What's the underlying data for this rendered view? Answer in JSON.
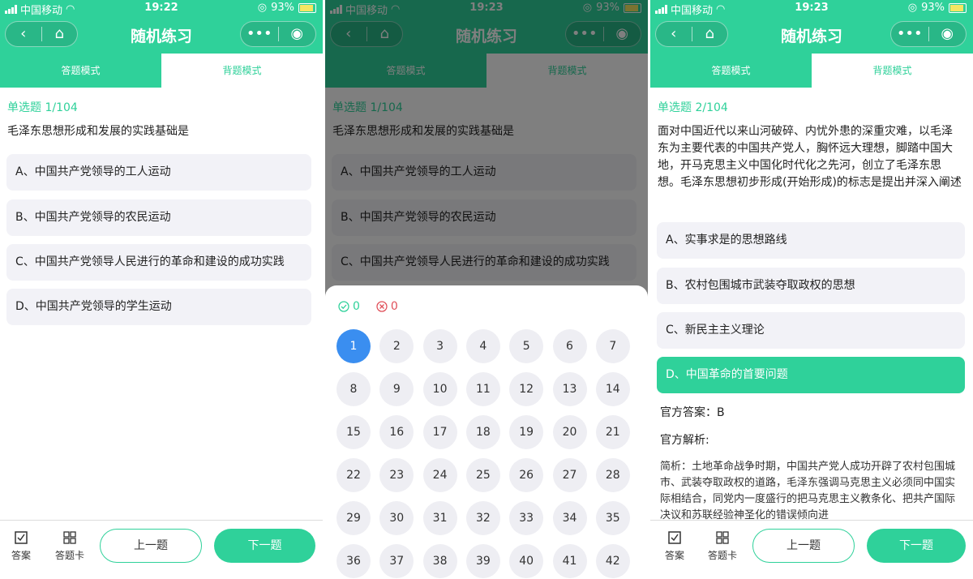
{
  "status": {
    "carrier": "中国移动",
    "battery": "93%"
  },
  "screens": [
    {
      "time": "19:22",
      "title": "随机练习",
      "tabs": [
        "答题模式",
        "背题模式"
      ],
      "question_label": "单选题 1/104",
      "question": "毛泽东思想形成和发展的实践基础是",
      "options": [
        "A、中国共产党领导的工人运动",
        "B、中国共产党领导的农民运动",
        "C、中国共产党领导人民进行的革命和建设的成功实践",
        "D、中国共产党领导的学生运动"
      ],
      "bottom": {
        "answer_label": "答案",
        "card_label": "答题卡",
        "prev": "上一题",
        "next": "下一题"
      }
    },
    {
      "time": "19:23",
      "title": "随机练习",
      "tabs": [
        "答题模式",
        "背题模式"
      ],
      "question_label": "单选题 1/104",
      "question": "毛泽东思想形成和发展的实践基础是",
      "options": [
        "A、中国共产党领导的工人运动",
        "B、中国共产党领导的农民运动",
        "C、中国共产党领导人民进行的革命和建设的成功实践"
      ],
      "sheet": {
        "correct_count": "0",
        "wrong_count": "0",
        "current": 1,
        "numbers": [
          "1",
          "2",
          "3",
          "4",
          "5",
          "6",
          "7",
          "8",
          "9",
          "10",
          "11",
          "12",
          "13",
          "14",
          "15",
          "16",
          "17",
          "18",
          "19",
          "20",
          "21",
          "22",
          "23",
          "24",
          "25",
          "26",
          "27",
          "28",
          "29",
          "30",
          "31",
          "32",
          "33",
          "34",
          "35",
          "36",
          "37",
          "38",
          "39",
          "40",
          "41",
          "42"
        ]
      }
    },
    {
      "time": "19:23",
      "title": "随机练习",
      "tabs": [
        "答题模式",
        "背题模式"
      ],
      "question_label": "单选题 2/104",
      "question": "面对中国近代以来山河破碎、内忧外患的深重灾难，以毛泽东为主要代表的中国共产党人，胸怀远大理想，脚踏中国大地，开马克思主义中国化时代化之先河，创立了毛泽东思想。毛泽东思想初步形成(开始形成)的标志是提出并深入阐述",
      "options": [
        "A、实事求是的思想路线",
        "B、农村包围城市武装夺取政权的思想",
        "C、新民主主义理论",
        "D、中国革命的首要问题"
      ],
      "selected_option": "D",
      "official_answer": "官方答案：B",
      "analysis_title": "官方解析:",
      "analysis": "简析：土地革命战争时期，中国共产党人成功开辟了农村包围城市、武装夺取政权的道路，毛泽东强调马克思主义必须同中国实际相结合，同党内一度盛行的把马克思主义教条化、把共产国际决议和苏联经验神圣化的错误倾向进",
      "bottom": {
        "answer_label": "答案",
        "card_label": "答题卡",
        "prev": "上一题",
        "next": "下一题"
      }
    }
  ],
  "colors": {
    "accent": "#2fd19a",
    "current_blue": "#3a8ef0",
    "wrong_red": "#e0505a"
  }
}
